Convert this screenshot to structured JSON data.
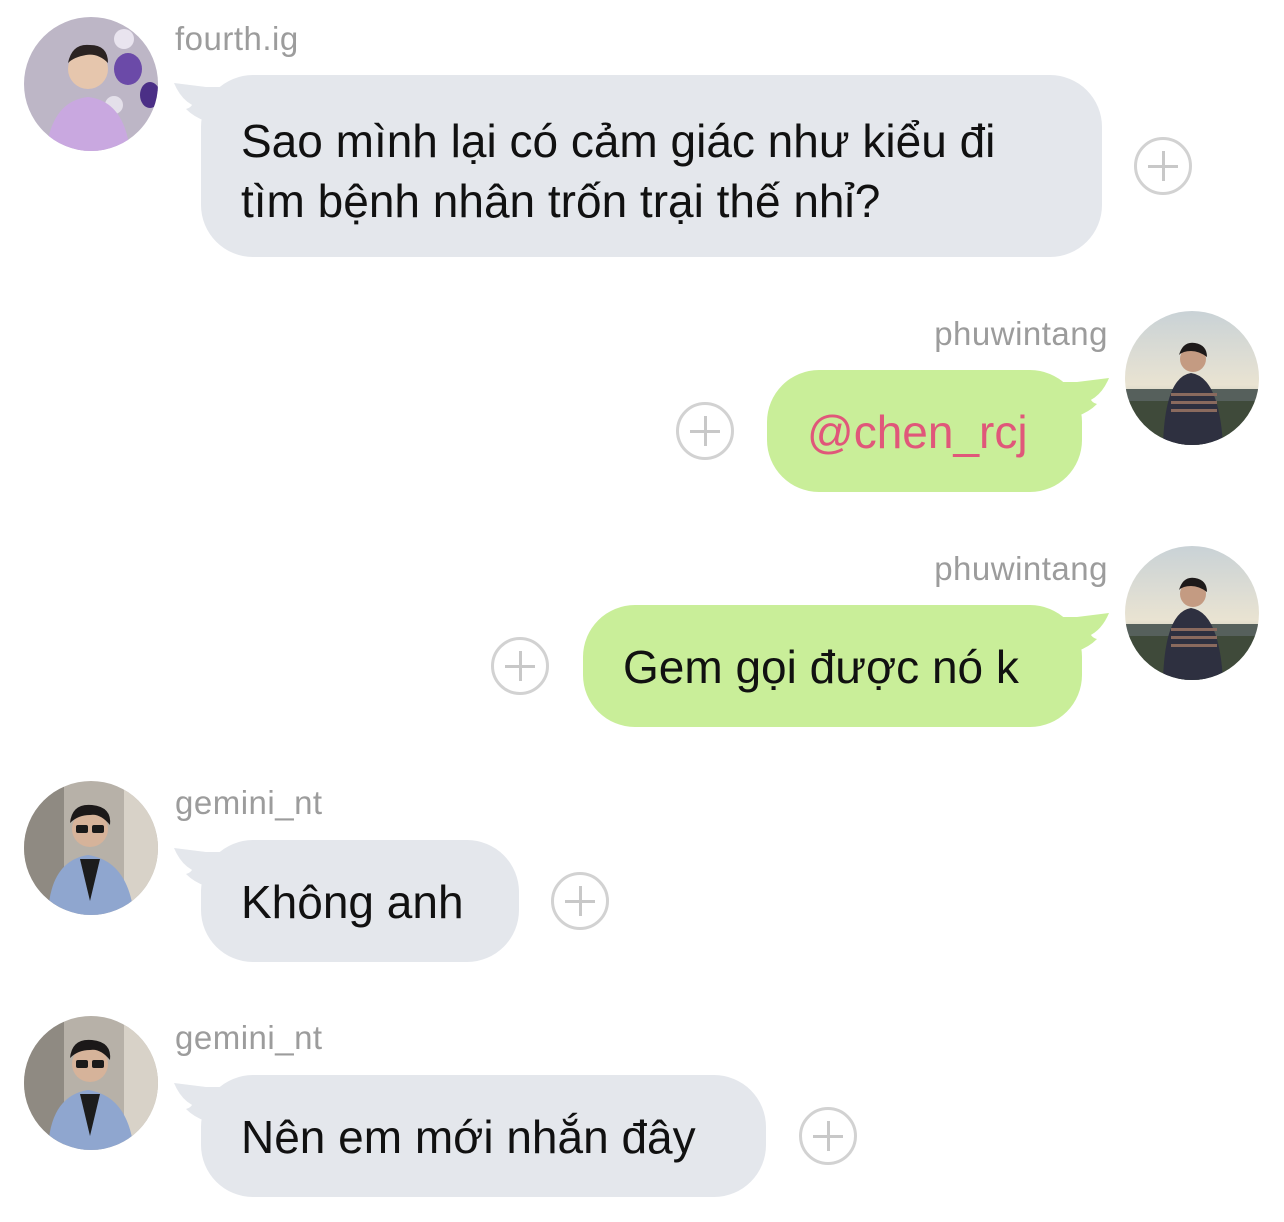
{
  "messages": [
    {
      "sender": "fourth.ig",
      "direction": "incoming",
      "text_lines": [
        "Sao mình lại có cảm giác như kiểu đi",
        "tìm bệnh nhân trốn trại thế nhỉ?"
      ],
      "avatar_icon": "avatar-fourth-ig"
    },
    {
      "sender": "phuwintang",
      "direction": "outgoing",
      "text": "@chen_rcj",
      "is_mention": true,
      "avatar_icon": "avatar-phuwintang"
    },
    {
      "sender": "phuwintang",
      "direction": "outgoing",
      "text": "Gem gọi được nó k",
      "avatar_icon": "avatar-phuwintang"
    },
    {
      "sender": "gemini_nt",
      "direction": "incoming",
      "text": "Không anh",
      "avatar_icon": "avatar-gemini-nt"
    },
    {
      "sender": "gemini_nt",
      "direction": "incoming",
      "text": "Nên em mới nhắn đây",
      "avatar_icon": "avatar-gemini-nt"
    }
  ],
  "react_button_icon": "plus-circle-icon",
  "colors": {
    "incoming_bubble": "#e4e7ec",
    "outgoing_bubble": "#c9ee99",
    "username": "#9c9c9c",
    "mention": "#e0577a",
    "react_button": "#d2d2d2"
  }
}
